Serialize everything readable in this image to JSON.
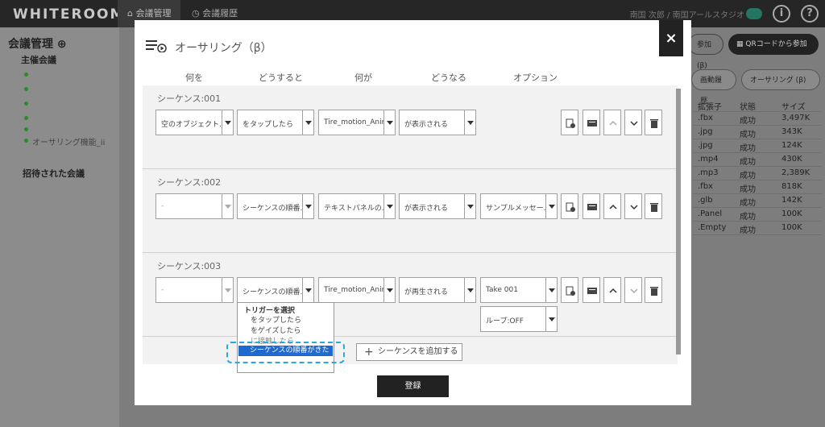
{
  "app": {
    "logo": "WHITEROOM",
    "nav_tabs": [
      {
        "label": "会議管理"
      },
      {
        "label": "会議履歴"
      }
    ],
    "user_name": "南国 次郎 / 南国アールスタジオ"
  },
  "sidebar": {
    "title": "会議管理",
    "hosted": "主催会議",
    "items": [
      {
        "label": ""
      },
      {
        "label": ""
      },
      {
        "label": ""
      },
      {
        "label": ""
      },
      {
        "label": ""
      },
      {
        "label": "オーサリング機能_ii"
      }
    ],
    "invited": "招待された会議"
  },
  "right_panel": {
    "join_button": "参加 (β)",
    "qr_button": "QRコードから参加",
    "history_button": "画動履歴",
    "authoring_button": "オーサリング (β)",
    "headers": [
      "拡張子",
      "状態",
      "サイズ"
    ],
    "rows": [
      [
        ".fbx",
        "成功",
        "3,497K"
      ],
      [
        ".jpg",
        "成功",
        "343K"
      ],
      [
        ".jpg",
        "成功",
        "124K"
      ],
      [
        ".mp4",
        "成功",
        "430K"
      ],
      [
        ".mp3",
        "成功",
        "2,389K"
      ],
      [
        ".fbx",
        "成功",
        "818K"
      ],
      [
        ".glb",
        "成功",
        "142K"
      ],
      [
        ".Panel",
        "成功",
        "100K"
      ],
      [
        ".Empty",
        "成功",
        "100K"
      ]
    ]
  },
  "modal": {
    "title": "オーサリング（β）",
    "close": "×",
    "columns": [
      "何を",
      "どうすると",
      "何が",
      "どうなる",
      "オプション"
    ],
    "sequences": [
      {
        "title": "シーケンス:001",
        "what": "空のオブジェクト...",
        "action": "をタップしたら",
        "target": "Tire_motion_Anim...",
        "result": "が表示される",
        "option": ""
      },
      {
        "title": "シーケンス:002",
        "what": "-",
        "action": "シーケンスの順番...",
        "target": "テキストパネルの...",
        "result": "が表示される",
        "option": "サンプルメッセー..."
      },
      {
        "title": "シーケンス:003",
        "what": "-",
        "action": "シーケンスの順番...",
        "target": "Tire_motion_Anim...",
        "result": "が再生される",
        "option": "Take 001",
        "option2": "ループ:OFF"
      }
    ],
    "trigger_menu": {
      "header": "トリガーを選択",
      "items": [
        "をタップしたら",
        "をゲイズしたら",
        "に接触したら"
      ],
      "selected": "シーケンスの順番がきたら"
    },
    "add_sequence": "シーケンスを追加する",
    "register": "登録"
  }
}
